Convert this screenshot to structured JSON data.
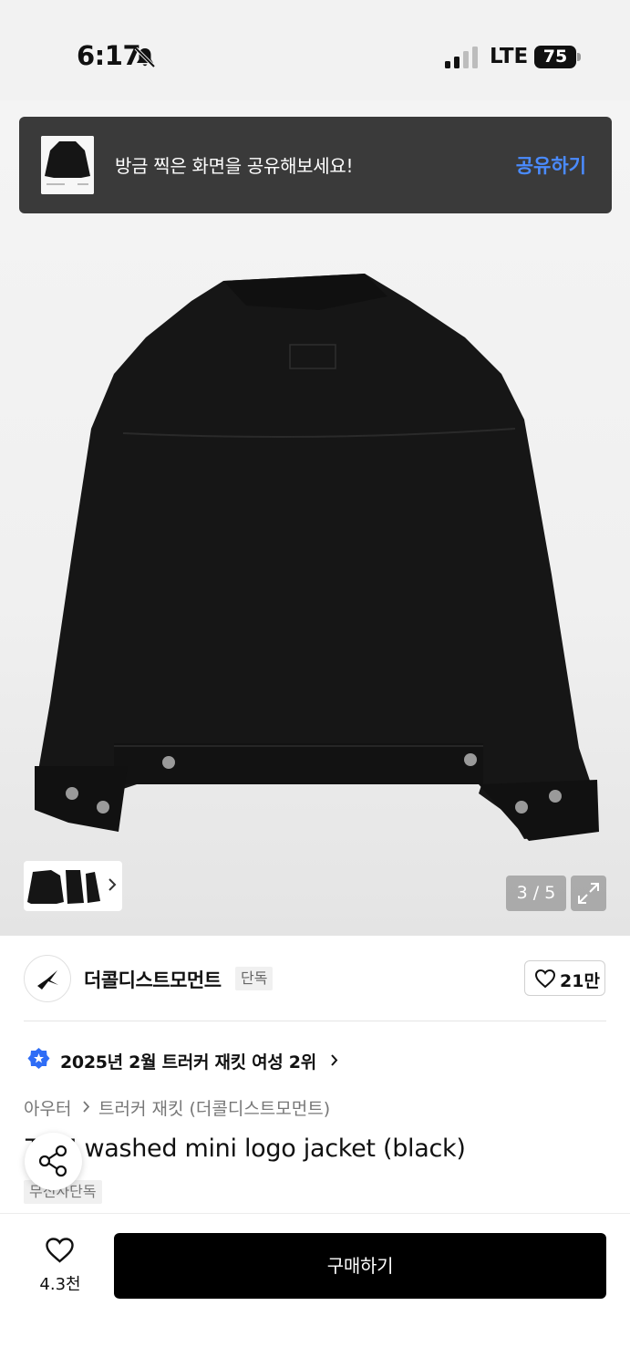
{
  "status_bar": {
    "time": "6:17",
    "network": "LTE",
    "battery": "75",
    "bell_icon": "bell-slash-icon",
    "signal_icon": "signal-bars-icon"
  },
  "toast": {
    "message": "방금 찍은 화면을 공유해보세요!",
    "action_label": "공유하기",
    "action_color": "#4a8bff"
  },
  "gallery": {
    "counter": "3 / 5",
    "expand_icon": "expand-icon",
    "thumbnail_chevron": "chevron-right-icon"
  },
  "brand": {
    "name": "더콜디스트모먼트",
    "badge": "단독",
    "likes": "21만"
  },
  "ranking": {
    "text": "2025년 2월 트러커 재킷 여성 2위"
  },
  "breadcrumb": {
    "level1": "아우터",
    "level2": "트러커 재킷 (더콜디스트모먼트)"
  },
  "product": {
    "title": "TCM washed mini logo jacket (black)",
    "tag": "무신사단독"
  },
  "bottom_bar": {
    "wish_count": "4.3천",
    "buy_label": "구매하기"
  }
}
